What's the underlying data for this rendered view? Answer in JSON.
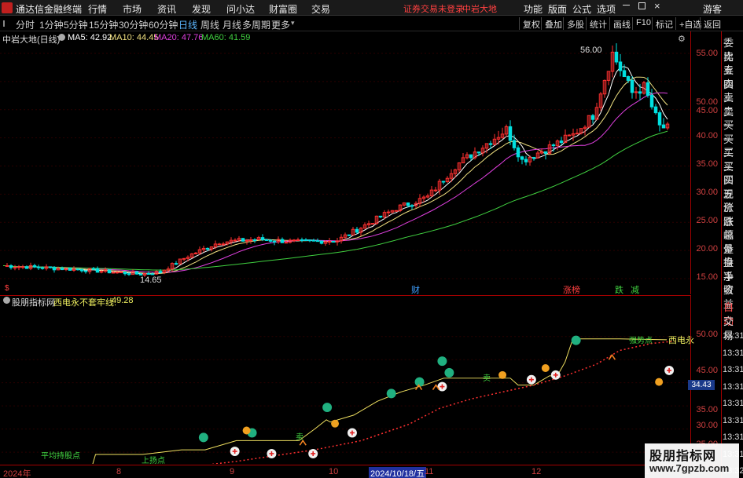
{
  "app": {
    "title": "通达信金融终端",
    "menus": [
      "行情",
      "市场",
      "资讯",
      "发现",
      "问小达",
      "财富圈",
      "交易"
    ],
    "warning": "证券交易未登录",
    "stock_name_top": "中岩大地",
    "right_menus": [
      "功能",
      "版面",
      "公式",
      "选项"
    ],
    "guest": "游客"
  },
  "period_tabs": [
    "分时",
    "1分钟",
    "5分钟",
    "15分钟",
    "30分钟",
    "60分钟",
    "日线",
    "周线",
    "月线",
    "多周期",
    "更多"
  ],
  "active_tab": "日线",
  "toolbar_buttons": [
    "复权",
    "叠加",
    "多股",
    "统计",
    "画线",
    "F10",
    "标记",
    "+自选",
    "返回"
  ],
  "main_chart": {
    "title": "中岩大地(日线)",
    "ma": [
      {
        "label": "MA5: 42.92",
        "color": "#ffffff"
      },
      {
        "label": "MA10: 44.45",
        "color": "#f0e080"
      },
      {
        "label": "MA20: 47.76",
        "color": "#e040e0"
      },
      {
        "label": "MA60: 41.59",
        "color": "#40d040"
      }
    ],
    "high_label": "56.00",
    "low_label": "14.65",
    "price_ticks": [
      "55.00",
      "50.00",
      "45.00",
      "40.00",
      "35.00",
      "30.00",
      "25.00",
      "20.00",
      "15.00"
    ],
    "event_marks": [
      {
        "text": "财",
        "color": "#40a0ff"
      },
      {
        "text": "涨榜",
        "color": "#ff4040"
      },
      {
        "text": "跌",
        "color": "#40d040"
      },
      {
        "text": "减",
        "color": "#40d040"
      },
      {
        "text": "$",
        "color": "#ff4040"
      }
    ]
  },
  "indicator": {
    "source": "股朋指标网",
    "name": "西电永不套牢线:",
    "value": "49.28",
    "ticks": [
      "50.00",
      "45.00",
      "40.00",
      "35.00",
      "30.00",
      "25.00"
    ],
    "current_tag": "34.43",
    "line_label": "西电永",
    "texts": [
      "卖",
      "卖",
      "卖",
      "强势点",
      "平均持股点",
      "上扬点"
    ]
  },
  "right_panel": {
    "items": [
      "委比",
      "卖五",
      "卖四",
      "卖三",
      "卖二",
      "卖一",
      "买一",
      "买二",
      "买三",
      "买四",
      "买五",
      "现价",
      "涨跌",
      "涨幅",
      "总量",
      "外盘",
      "换手",
      "净资",
      "收益"
    ],
    "bottom": [
      "自动",
      "交易"
    ],
    "times": [
      "13:31",
      "13:31",
      "13:31",
      "13:31",
      "13:31",
      "13:31",
      "13:31",
      "13:31",
      "13:32"
    ]
  },
  "date_axis": [
    "2024年",
    "8",
    "9",
    "10",
    "2024/10/18/五",
    "11",
    "12",
    "1"
  ],
  "watermark": {
    "line1": "股朋指标网",
    "line2": "www.7gpzb.com"
  }
}
